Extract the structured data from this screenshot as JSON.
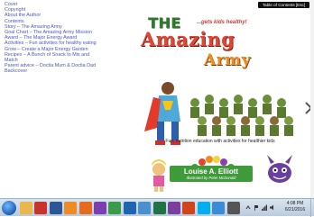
{
  "toc": {
    "items": [
      "Cover",
      "Copyright",
      "About the Author",
      "Contents",
      "Story – The Amazing Army",
      "Goal Chart – The Amazing Army Mission",
      "Award – The Major Energy Award",
      "Activities – Fun activities for healthy eating",
      "Grow – Create a Major Energy Garden",
      "Recipes – A Bunch of Snack to Mix and",
      "Match",
      "Parent advice – Doctia Mum & Doctia Dad",
      "Backcover"
    ]
  },
  "reader": {
    "toc_button_label": "Table of Contents [Esc]",
    "next_icon": "chevron-right-icon"
  },
  "cover": {
    "title_the": "THE",
    "tagline": "...gets kids healthy!",
    "title_amazing": "Amazing",
    "title_army": "Army",
    "subtitle": "Fun, nutrition education with activities for healthier kids",
    "author": "Louise A. Elliott",
    "illustrator": "Illustrated by Peter McDonald",
    "colors": {
      "title_green": "#2f7d2b",
      "title_red": "#e24633",
      "title_orange": "#f28c1e",
      "banner_green": "#3f9a3a"
    }
  },
  "taskbar": {
    "start_icon": "windows-start-icon",
    "apps": [
      {
        "icon": "folder-icon",
        "color": "#e8b84a"
      },
      {
        "icon": "acrobat-icon",
        "color": "#c8342b"
      },
      {
        "icon": "word-icon",
        "color": "#2b5797"
      },
      {
        "icon": "media-player-icon",
        "color": "#f08a24"
      },
      {
        "icon": "firefox-icon",
        "color": "#e66a1f"
      },
      {
        "icon": "music-icon",
        "color": "#7a3fb0"
      },
      {
        "icon": "chrome-icon",
        "color": "#3b9b48"
      },
      {
        "icon": "outlook-icon",
        "color": "#1f66b2"
      },
      {
        "icon": "pictures-icon",
        "color": "#4a8fd0"
      },
      {
        "icon": "excel-icon",
        "color": "#217346"
      },
      {
        "icon": "onenote-icon",
        "color": "#7b3f9e"
      },
      {
        "icon": "powerpoint-icon",
        "color": "#d0451b"
      },
      {
        "icon": "skype-icon",
        "color": "#00aff0"
      },
      {
        "icon": "paint-icon",
        "color": "#3c8ad8"
      },
      {
        "icon": "ebook-reader-icon",
        "color": "#555555"
      }
    ],
    "clock_time": "4:08 PM",
    "clock_date": "6/21/2016"
  }
}
